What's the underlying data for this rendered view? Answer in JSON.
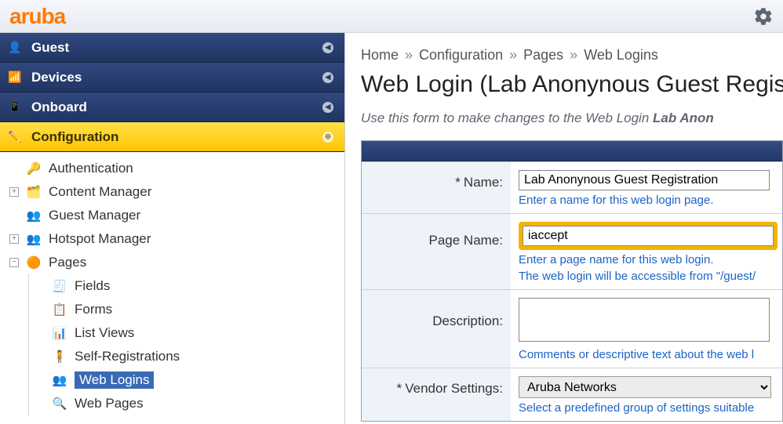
{
  "brand": "aruba",
  "accordion": [
    {
      "key": "guest",
      "label": "Guest",
      "icon": "👤"
    },
    {
      "key": "devices",
      "label": "Devices",
      "icon": "📶"
    },
    {
      "key": "onboard",
      "label": "Onboard",
      "icon": "📱"
    },
    {
      "key": "config",
      "label": "Configuration",
      "icon": "✏️",
      "selected": true
    }
  ],
  "tree": {
    "top": [
      {
        "label": "Authentication",
        "icon": "🔑",
        "exp": ""
      },
      {
        "label": "Content Manager",
        "icon": "🗂️",
        "exp": "+"
      },
      {
        "label": "Guest Manager",
        "icon": "👥",
        "exp": ""
      },
      {
        "label": "Hotspot Manager",
        "icon": "👥",
        "exp": "+"
      }
    ],
    "pages": {
      "label": "Pages",
      "icon": "🟠",
      "exp": "−"
    },
    "children": [
      {
        "label": "Fields",
        "icon": "🧾"
      },
      {
        "label": "Forms",
        "icon": "📋"
      },
      {
        "label": "List Views",
        "icon": "📊"
      },
      {
        "label": "Self-Registrations",
        "icon": "🧍"
      },
      {
        "label": "Web Logins",
        "icon": "👥",
        "selected": true
      },
      {
        "label": "Web Pages",
        "icon": "🔍"
      }
    ]
  },
  "breadcrumb": [
    "Home",
    "Configuration",
    "Pages",
    "Web Logins"
  ],
  "title": "Web Login (Lab Anonynous Guest Regist",
  "subhead_prefix": "Use this form to make changes to the Web Login ",
  "subhead_bold": "Lab Anon",
  "form": {
    "name": {
      "label": "Name:",
      "value": "Lab Anonynous Guest Registration",
      "hint": "Enter a name for this web login page."
    },
    "page_name": {
      "label": "Page Name:",
      "value": "iaccept",
      "hint1": "Enter a page name for this web login.",
      "hint2": "The web login will be accessible from \"/guest/"
    },
    "description": {
      "label": "Description:",
      "value": "",
      "hint": "Comments or descriptive text about the web l"
    },
    "vendor": {
      "label": "Vendor Settings:",
      "value": "Aruba Networks",
      "hint": "Select a predefined group of settings suitable"
    }
  }
}
